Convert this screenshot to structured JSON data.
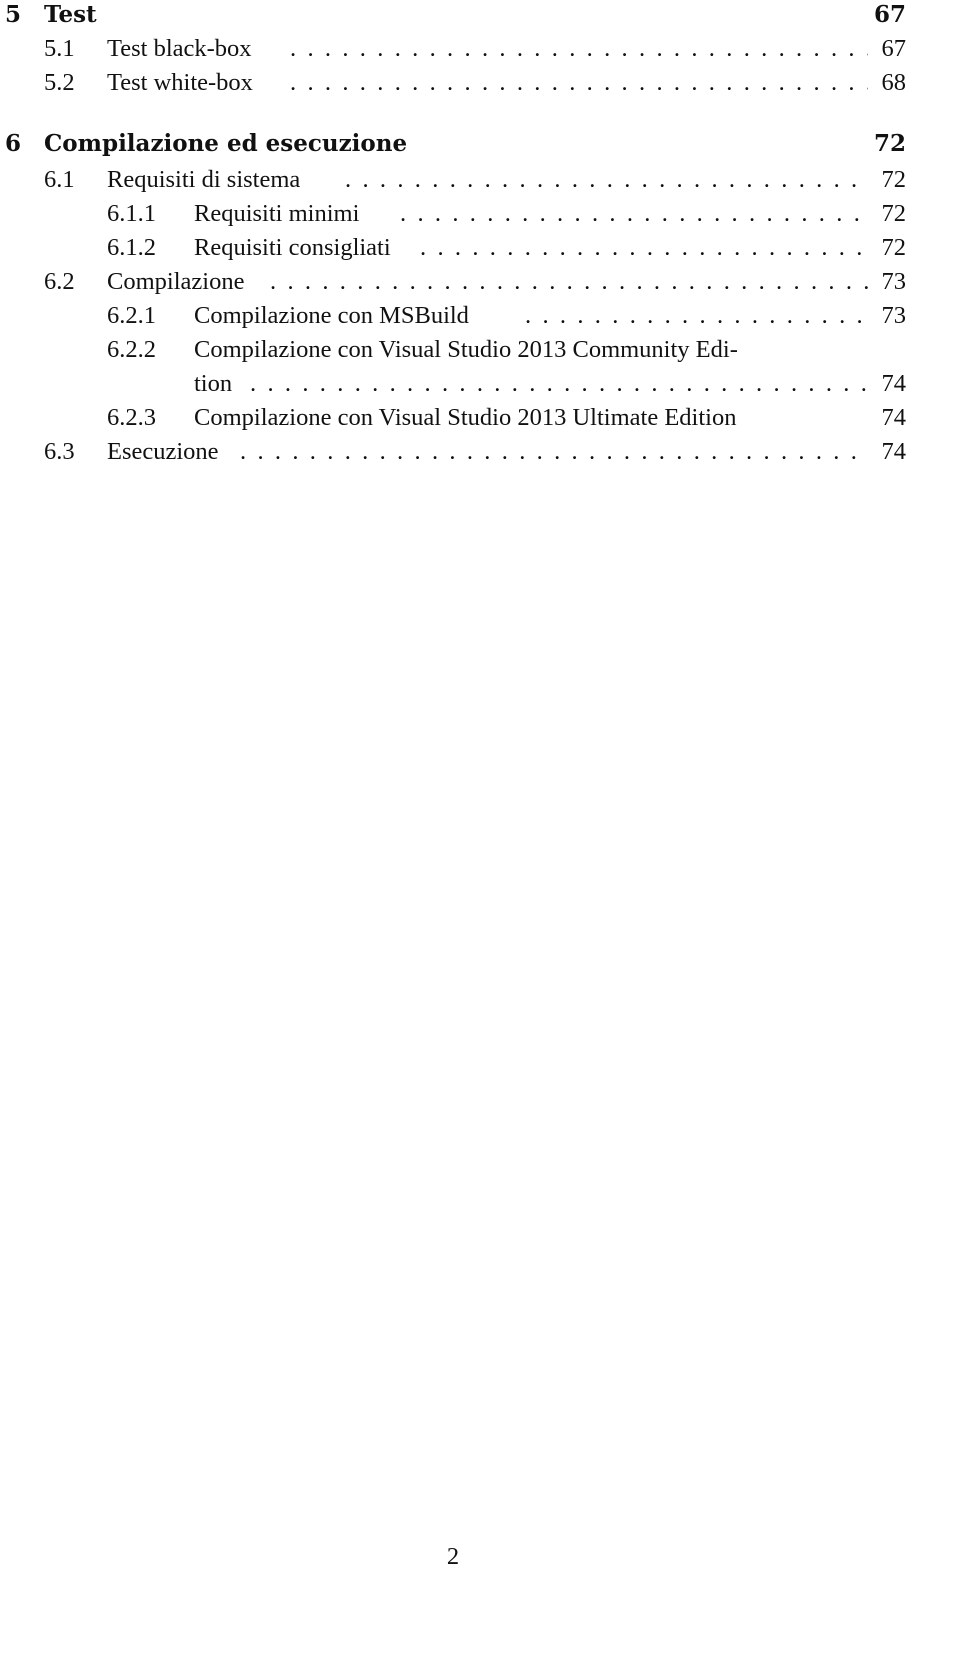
{
  "toc": {
    "ch5": {
      "num": "5",
      "title": "Test",
      "page": "67"
    },
    "s5_1": {
      "num": "5.1",
      "title": "Test black-box",
      "page": "67"
    },
    "s5_2": {
      "num": "5.2",
      "title": "Test white-box",
      "page": "68"
    },
    "ch6": {
      "num": "6",
      "title": "Compilazione ed esecuzione",
      "page": "72"
    },
    "s6_1": {
      "num": "6.1",
      "title": "Requisiti di sistema",
      "page": "72"
    },
    "s6_1_1": {
      "num": "6.1.1",
      "title": "Requisiti minimi",
      "page": "72"
    },
    "s6_1_2": {
      "num": "6.1.2",
      "title": "Requisiti consigliati",
      "page": "72"
    },
    "s6_2": {
      "num": "6.2",
      "title": "Compilazione",
      "page": "73"
    },
    "s6_2_1": {
      "num": "6.2.1",
      "title": "Compilazione con MSBuild",
      "page": "73"
    },
    "s6_2_2": {
      "num": "6.2.2",
      "title_line1": "Compilazione con Visual Studio 2013 Community Edi-",
      "title_line2": "tion",
      "page": "74"
    },
    "s6_2_3": {
      "num": "6.2.3",
      "title": "Compilazione con Visual Studio 2013 Ultimate Edition",
      "page": "74"
    },
    "s6_3": {
      "num": "6.3",
      "title": "Esecuzione",
      "page": "74"
    }
  },
  "footer": {
    "page_number": "2"
  }
}
